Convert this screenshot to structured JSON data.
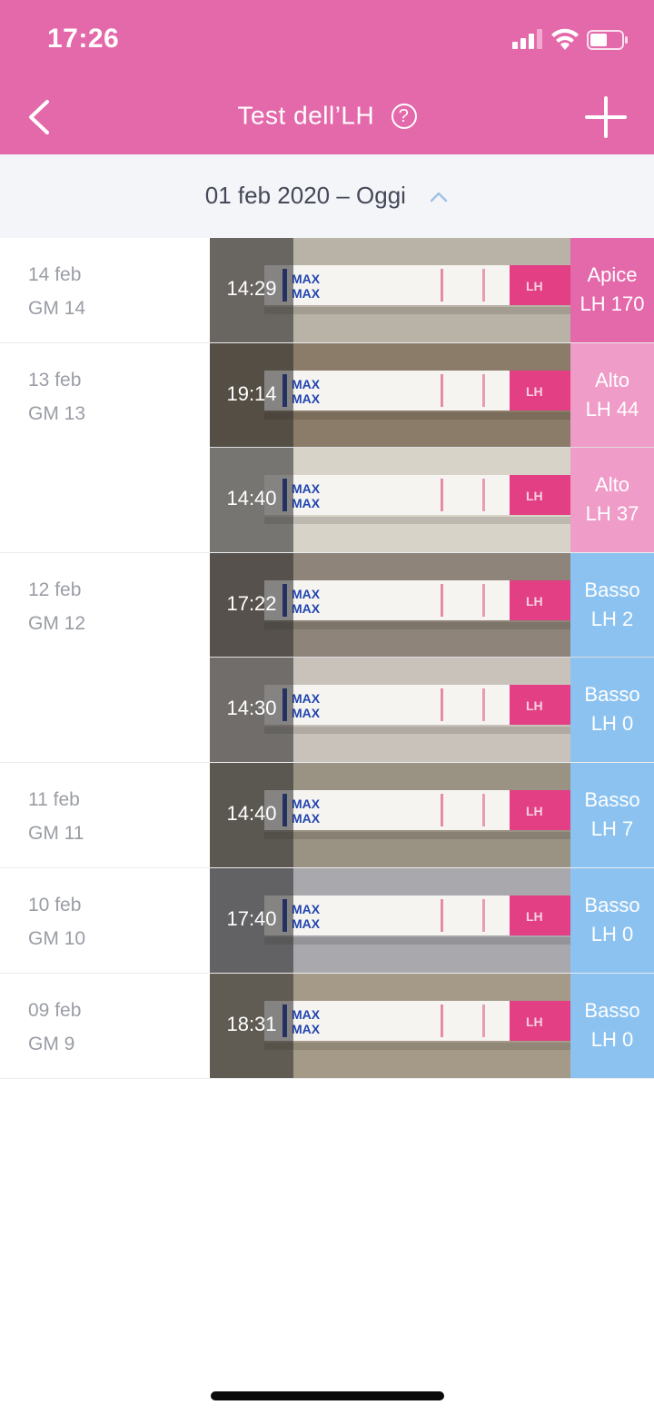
{
  "status": {
    "time": "17:26"
  },
  "nav": {
    "title": "Test dell’LH",
    "help": "?"
  },
  "range": {
    "label": "01 feb 2020 – Oggi"
  },
  "colors": {
    "brand": "#e469aa",
    "peak": "#e469aa",
    "high": "#ef9cc8",
    "low": "#8cc2f0"
  },
  "days": [
    {
      "date": "14 feb",
      "cycle_day": "GM 14",
      "entries": [
        {
          "time": "14:29",
          "level": "Apice",
          "value": "LH 170",
          "category": "peak"
        }
      ]
    },
    {
      "date": "13 feb",
      "cycle_day": "GM 13",
      "entries": [
        {
          "time": "19:14",
          "level": "Alto",
          "value": "LH 44",
          "category": "high"
        },
        {
          "time": "14:40",
          "level": "Alto",
          "value": "LH 37",
          "category": "high"
        }
      ]
    },
    {
      "date": "12 feb",
      "cycle_day": "GM 12",
      "entries": [
        {
          "time": "17:22",
          "level": "Basso",
          "value": "LH 2",
          "category": "low"
        },
        {
          "time": "14:30",
          "level": "Basso",
          "value": "LH 0",
          "category": "low"
        }
      ]
    },
    {
      "date": "11 feb",
      "cycle_day": "GM 11",
      "entries": [
        {
          "time": "14:40",
          "level": "Basso",
          "value": "LH 7",
          "category": "low"
        }
      ]
    },
    {
      "date": "10 feb",
      "cycle_day": "GM 10",
      "entries": [
        {
          "time": "17:40",
          "level": "Basso",
          "value": "LH 0",
          "category": "low"
        }
      ]
    },
    {
      "date": "09 feb",
      "cycle_day": "GM 9",
      "entries": [
        {
          "time": "18:31",
          "level": "Basso",
          "value": "LH 0",
          "category": "low"
        }
      ]
    }
  ],
  "strip": {
    "max_label": "MAX",
    "brand_mark": "LH"
  }
}
